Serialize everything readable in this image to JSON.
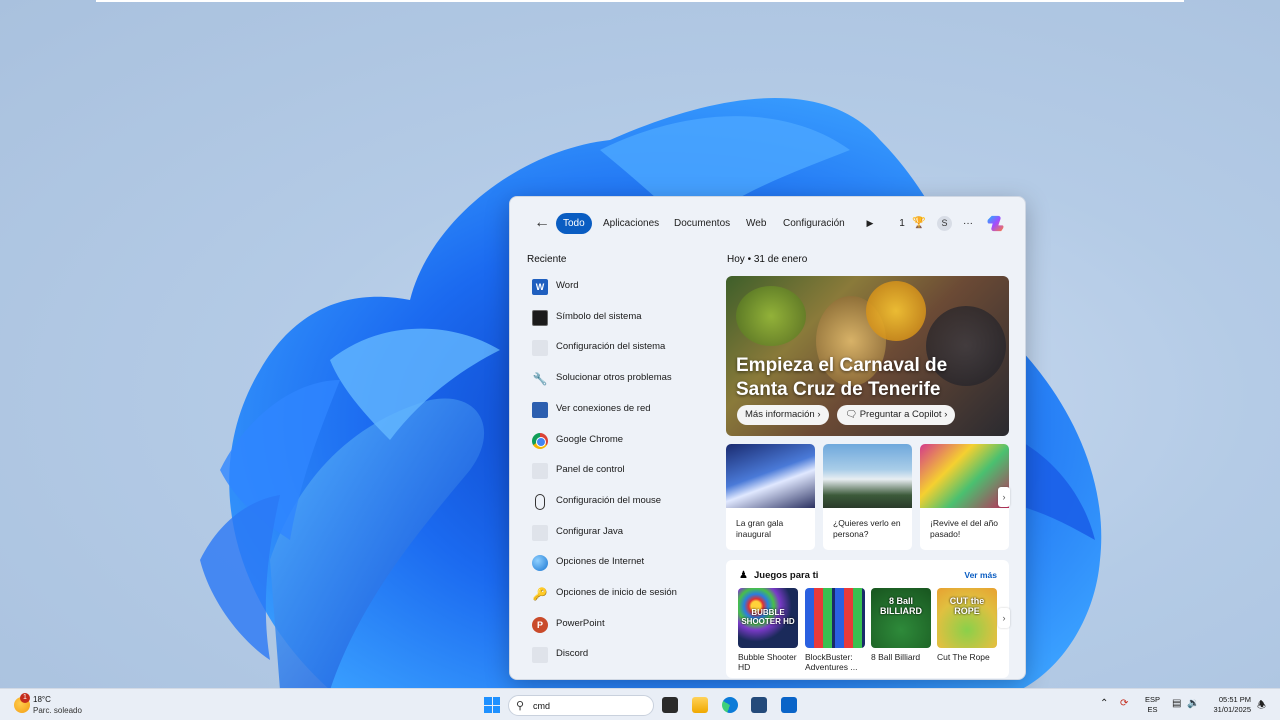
{
  "colors": {
    "accent": "#0a5dc2",
    "wallpaper_blue": "#1a5fe0"
  },
  "tabs": {
    "back_icon": "back-arrow-icon",
    "items": [
      "Todo",
      "Aplicaciones",
      "Documentos",
      "Web",
      "Configuración"
    ],
    "more_icon": "play-icon",
    "points": "1",
    "trophy_icon": "trophy-icon",
    "avatar": "S",
    "overflow": "···",
    "copilot_icon": "copilot-icon"
  },
  "recent": {
    "title": "Reciente",
    "items": [
      {
        "label": "Word",
        "icon": "word-icon"
      },
      {
        "label": "Símbolo del sistema",
        "icon": "cmd-icon"
      },
      {
        "label": "Configuración del sistema",
        "icon": "settings-icon"
      },
      {
        "label": "Solucionar otros problemas",
        "icon": "wrench-icon"
      },
      {
        "label": "Ver conexiones de red",
        "icon": "network-icon"
      },
      {
        "label": "Google Chrome",
        "icon": "chrome-icon"
      },
      {
        "label": "Panel de control",
        "icon": "control-panel-icon"
      },
      {
        "label": "Configuración del mouse",
        "icon": "mouse-icon"
      },
      {
        "label": "Configurar Java",
        "icon": "java-icon"
      },
      {
        "label": "Opciones de Internet",
        "icon": "globe-icon"
      },
      {
        "label": "Opciones de inicio de sesión",
        "icon": "key-icon"
      },
      {
        "label": "PowerPoint",
        "icon": "powerpoint-icon"
      },
      {
        "label": "Discord",
        "icon": "discord-icon"
      }
    ]
  },
  "today": {
    "label": "Hoy",
    "dot": "•",
    "date": "31 de enero",
    "hero_title": "Empieza el Carnaval de Santa Cruz de Tenerife",
    "more_info": "Más información",
    "ask_copilot": "Preguntar a Copilot",
    "cards": [
      "La gran gala inaugural",
      "¿Quieres verlo en persona?",
      "¡Revive el del año pasado!"
    ]
  },
  "games": {
    "title": "Juegos para ti",
    "see_more": "Ver más",
    "items": [
      {
        "name": "Bubble Shooter HD",
        "thumb_text": "BUBBLE SHOOTER HD"
      },
      {
        "name": "BlockBuster: Adventures ...",
        "thumb_text": ""
      },
      {
        "name": "8 Ball Billiard",
        "thumb_text": "8 Ball BILLIARD"
      },
      {
        "name": "Cut The Rope",
        "thumb_text": "CUT the ROPE"
      }
    ]
  },
  "taskbar": {
    "weather_badge": "1",
    "temperature": "18°C",
    "condition": "Parc. soleado",
    "search_value": "cmd",
    "lang_top": "ESP",
    "lang_bottom": "ES",
    "time": "05:51 PM",
    "date": "31/01/2025"
  }
}
